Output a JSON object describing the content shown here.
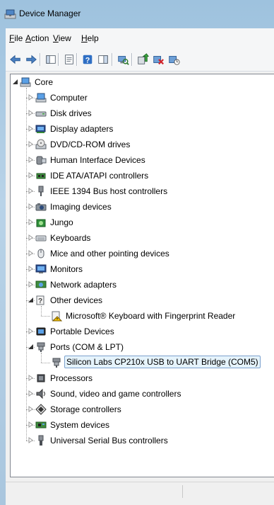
{
  "window": {
    "title": "Device Manager"
  },
  "menu": [
    {
      "label": "File",
      "u": "F",
      "rest": "ile"
    },
    {
      "label": "Action",
      "u": "A",
      "rest": "ction"
    },
    {
      "label": "View",
      "u": "V",
      "rest": "iew"
    },
    {
      "label": "Help",
      "u": "H",
      "rest": "elp"
    }
  ],
  "toolbar": [
    {
      "icon": "back-arrow-icon"
    },
    {
      "icon": "forward-arrow-icon"
    },
    {
      "icon": "show-hide-console-tree-icon"
    },
    {
      "icon": "properties-icon"
    },
    {
      "icon": "help-icon"
    },
    {
      "icon": "show-action-pane-icon"
    },
    {
      "icon": "scan-hardware-changes-icon"
    },
    {
      "icon": "update-driver-icon"
    },
    {
      "icon": "uninstall-icon"
    },
    {
      "icon": "disable-device-icon"
    }
  ],
  "tree": {
    "root": {
      "label": "Core",
      "icon": "computer-icon",
      "expanded": true
    },
    "categories": [
      {
        "label": "Computer",
        "icon": "computer-icon",
        "expanded": false
      },
      {
        "label": "Disk drives",
        "icon": "disk-drive-icon",
        "expanded": false
      },
      {
        "label": "Display adapters",
        "icon": "display-adapter-icon",
        "expanded": false
      },
      {
        "label": "DVD/CD-ROM drives",
        "icon": "dvd-drive-icon",
        "expanded": false
      },
      {
        "label": "Human Interface Devices",
        "icon": "hid-icon",
        "expanded": false
      },
      {
        "label": "IDE ATA/ATAPI controllers",
        "icon": "ide-controller-icon",
        "expanded": false
      },
      {
        "label": "IEEE 1394 Bus host controllers",
        "icon": "ieee1394-icon",
        "expanded": false
      },
      {
        "label": "Imaging devices",
        "icon": "imaging-device-icon",
        "expanded": false
      },
      {
        "label": "Jungo",
        "icon": "jungo-icon",
        "expanded": false
      },
      {
        "label": "Keyboards",
        "icon": "keyboard-icon",
        "expanded": false
      },
      {
        "label": "Mice and other pointing devices",
        "icon": "mouse-icon",
        "expanded": false
      },
      {
        "label": "Monitors",
        "icon": "monitor-icon",
        "expanded": false
      },
      {
        "label": "Network adapters",
        "icon": "network-adapter-icon",
        "expanded": false
      },
      {
        "label": "Other devices",
        "icon": "other-devices-icon",
        "expanded": true,
        "children": [
          {
            "label": "Microsoft® Keyboard with Fingerprint Reader",
            "icon": "warning-device-icon"
          }
        ]
      },
      {
        "label": "Portable Devices",
        "icon": "portable-device-icon",
        "expanded": false
      },
      {
        "label": "Ports (COM & LPT)",
        "icon": "port-icon",
        "expanded": true,
        "children": [
          {
            "label": "Silicon Labs CP210x USB to UART Bridge (COM5)",
            "icon": "port-icon",
            "selected": true
          }
        ]
      },
      {
        "label": "Processors",
        "icon": "processor-icon",
        "expanded": false
      },
      {
        "label": "Sound, video and game controllers",
        "icon": "sound-icon",
        "expanded": false
      },
      {
        "label": "Storage controllers",
        "icon": "storage-controller-icon",
        "expanded": false
      },
      {
        "label": "System devices",
        "icon": "system-device-icon",
        "expanded": false
      },
      {
        "label": "Universal Serial Bus controllers",
        "icon": "usb-icon",
        "expanded": false
      }
    ]
  }
}
